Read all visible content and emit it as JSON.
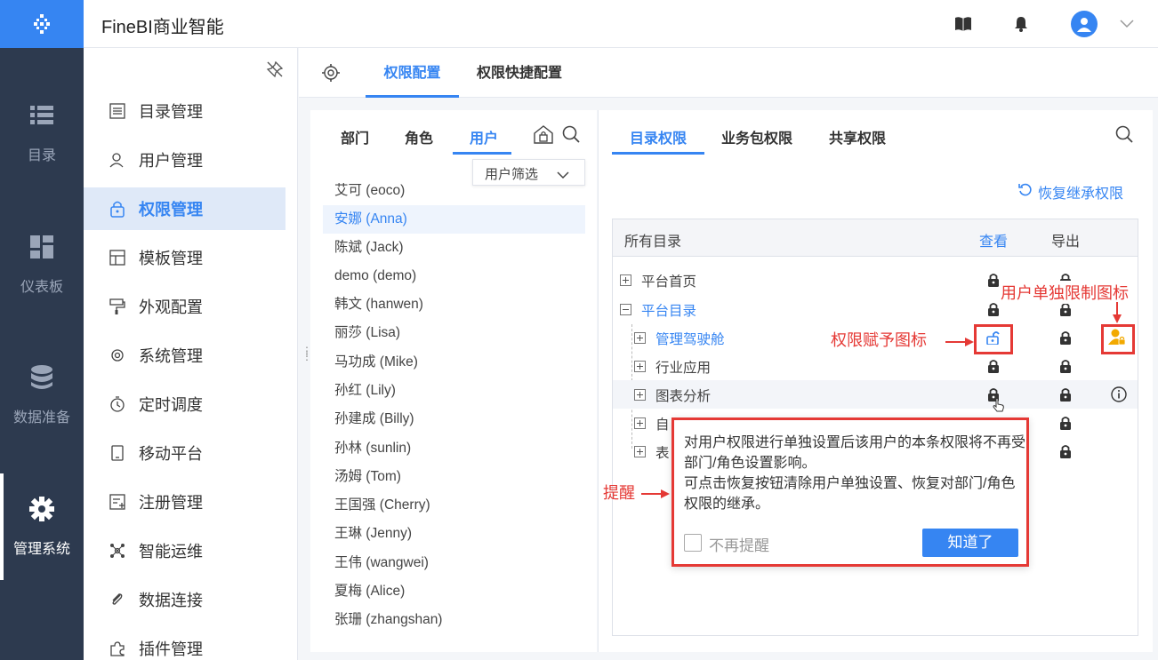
{
  "app": {
    "title": "FineBI商业智能"
  },
  "nav": {
    "items": [
      {
        "label": "目录",
        "icon": "list-icon"
      },
      {
        "label": "仪表板",
        "icon": "dashboard-icon"
      },
      {
        "label": "数据准备",
        "icon": "database-icon"
      },
      {
        "label": "管理系统",
        "icon": "gear-icon",
        "active": true
      }
    ]
  },
  "submenu": {
    "items": [
      {
        "label": "目录管理"
      },
      {
        "label": "用户管理"
      },
      {
        "label": "权限管理",
        "active": true
      },
      {
        "label": "模板管理"
      },
      {
        "label": "外观配置"
      },
      {
        "label": "系统管理"
      },
      {
        "label": "定时调度"
      },
      {
        "label": "移动平台"
      },
      {
        "label": "注册管理"
      },
      {
        "label": "智能运维"
      },
      {
        "label": "数据连接"
      },
      {
        "label": "插件管理"
      }
    ]
  },
  "tabs": {
    "permission_config": "权限配置",
    "quick_config": "权限快捷配置"
  },
  "userpanel": {
    "tabs": [
      "部门",
      "角色",
      "用户"
    ],
    "filter": "用户筛选",
    "users": [
      "艾可 (eoco)",
      "安娜 (Anna)",
      "陈斌 (Jack)",
      "demo (demo)",
      "韩文 (hanwen)",
      "丽莎 (Lisa)",
      "马功成 (Mike)",
      "孙红 (Lily)",
      "孙建成 (Billy)",
      "孙林 (sunlin)",
      "汤姆 (Tom)",
      "王国强 (Cherry)",
      "王琳 (Jenny)",
      "王伟 (wangwei)",
      "夏梅 (Alice)",
      "张珊 (zhangshan)"
    ]
  },
  "rightpanel": {
    "tabs": [
      "目录权限",
      "业务包权限",
      "共享权限"
    ],
    "restore": "恢复继承权限",
    "header": {
      "col_all": "所有目录",
      "col_view": "查看",
      "col_export": "导出"
    },
    "rows": [
      "平台首页",
      "平台目录",
      "管理驾驶舱",
      "行业应用",
      "图表分析",
      "自",
      "表"
    ]
  },
  "annotations": {
    "grant_icon": "权限赋予图标",
    "user_limit_icon": "用户单独限制图标",
    "reminder": "提醒"
  },
  "tooltip": {
    "line1": "对用户权限进行单独设置后该用户的本条权限将不再受部门/角色设置影响。",
    "line2": "可点击恢复按钮清除用户单独设置、恢复对部门/角色权限的继承。",
    "no_remind": "不再提醒",
    "ok": "知道了"
  },
  "colors": {
    "accent": "#3685f2",
    "nav_bg": "#2d3a4f",
    "annotation": "#e53935",
    "user_icon": "#f2a900"
  }
}
